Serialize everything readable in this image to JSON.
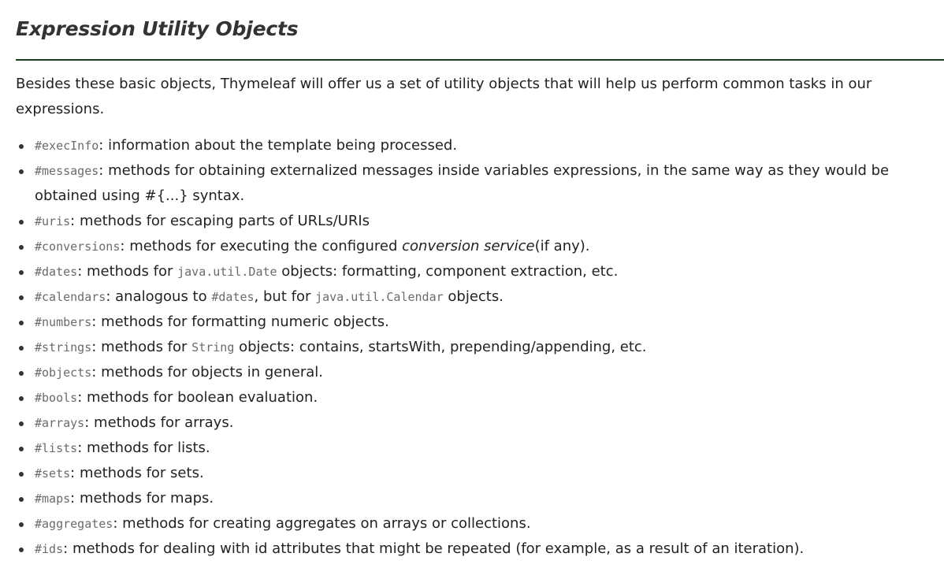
{
  "section": {
    "title": "Expression Utility Objects",
    "rule_color": "#14401e"
  },
  "intro": {
    "text": "Besides these basic objects, Thymeleaf will offer us a set of utility objects that will help us perform common tasks in our expressions."
  },
  "utility_objects": [
    {
      "name": "#execInfo",
      "separator": ":",
      "description": "information about the template being processed."
    },
    {
      "name": "#messages",
      "separator": ":",
      "description": "methods for obtaining externalized messages inside variables expressions, in the same way as they would be obtained using #{...} syntax."
    },
    {
      "name": "#uris",
      "separator": ":",
      "description": "methods for escaping parts of URLs/URIs"
    },
    {
      "name": "#conversions",
      "separator": ":",
      "description_before": "methods for executing the configured",
      "description_italic": "conversion service",
      "description_after": "(if any)."
    },
    {
      "name": "#dates",
      "separator": ":",
      "description_before": "methods for",
      "code_inline": "java.util.Date",
      "description_after": "objects: formatting, component extraction, etc."
    },
    {
      "name": "#calendars",
      "separator": ":",
      "description_before": "analogous to",
      "code_inline": "#dates",
      "description_middle": ", but for",
      "code_inline2": "java.util.Calendar",
      "description_after": "objects."
    },
    {
      "name": "#numbers",
      "separator": ":",
      "description": "methods for formatting numeric objects."
    },
    {
      "name": "#strings",
      "separator": ":",
      "description_before": "methods for",
      "code_inline": "String",
      "description_after": "objects: contains, startsWith, prepending/appending, etc."
    },
    {
      "name": "#objects",
      "separator": ":",
      "description": "methods for objects in general."
    },
    {
      "name": "#bools",
      "separator": ":",
      "description": "methods for boolean evaluation."
    },
    {
      "name": "#arrays",
      "separator": ":",
      "description": "methods for arrays."
    },
    {
      "name": "#lists",
      "separator": ":",
      "description": "methods for lists."
    },
    {
      "name": "#sets",
      "separator": ":",
      "description": "methods for sets."
    },
    {
      "name": "#maps",
      "separator": ":",
      "description": "methods for maps."
    },
    {
      "name": "#aggregates",
      "separator": ":",
      "description": "methods for creating aggregates on arrays or collections."
    },
    {
      "name": "#ids",
      "separator": ":",
      "description": "methods for dealing with id attributes that might be repeated (for example, as a result of an iteration)."
    }
  ]
}
